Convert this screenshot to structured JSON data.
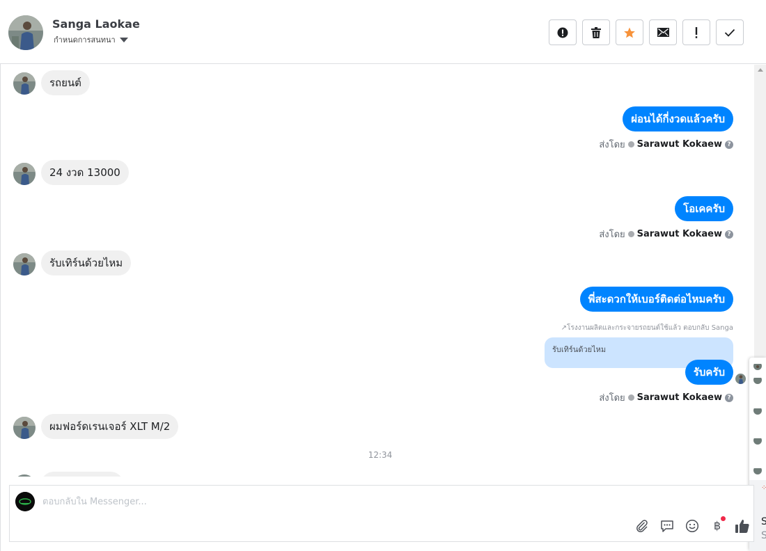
{
  "header": {
    "contact_name": "Sanga Laokae",
    "assign_label": "กำหนดการสนทนา",
    "actions": [
      {
        "name": "report-spam-button",
        "icon": "alert-circle-icon"
      },
      {
        "name": "delete-button",
        "icon": "trash-icon"
      },
      {
        "name": "star-button",
        "icon": "star-icon"
      },
      {
        "name": "mark-unread-button",
        "icon": "envelope-icon"
      },
      {
        "name": "mark-important-button",
        "icon": "exclamation-icon"
      },
      {
        "name": "mark-done-button",
        "icon": "checkmark-icon"
      }
    ]
  },
  "thread": {
    "messages": [
      {
        "dir": "in",
        "text": "รถยนต์"
      },
      {
        "dir": "out",
        "text": "ผ่อนได้กี่งวดแล้วครับ",
        "sent_by_label": "ส่งโดย",
        "sent_by": "Sarawut Kokaew"
      },
      {
        "dir": "in",
        "text": "24 งวด 13000"
      },
      {
        "dir": "out",
        "text": "โอเคครับ",
        "sent_by_label": "ส่งโดย",
        "sent_by": "Sarawut Kokaew"
      },
      {
        "dir": "in",
        "text": "รับเทิร์นด้วยไหม"
      },
      {
        "dir": "out",
        "text": "พี่สะดวกให้เบอร์ติดต่อไหมครับ"
      },
      {
        "dir": "out",
        "text": "รับครับ",
        "sent_by_label": "ส่งโดย",
        "sent_by": "Sarawut Kokaew"
      },
      {
        "dir": "in",
        "text": "ผมฟอร์ดเรนเจอร์ XLT M/2"
      }
    ],
    "reply_label": "โรงงานผลิตและกระจายรถยนต์ใช้แล้ว ตอบกลับ Sanga",
    "quoted_text": "รับเทิร์นด้วยไหม",
    "timestamp": "12:34"
  },
  "side_panel": {
    "letter_1": "S",
    "letter_2": "S"
  },
  "composer": {
    "placeholder": "ตอบกลับใน Messenger...",
    "tools": [
      "paperclip-icon",
      "chat-bubble-icon",
      "smiley-icon",
      "baht-icon",
      "thumbs-up-icon"
    ]
  },
  "colors": {
    "accent": "#0084ff",
    "incoming_bubble": "#f0f0f0",
    "quote_bg": "#cce4ff",
    "star": "#f7923a",
    "notification_dot": "#f02849"
  }
}
